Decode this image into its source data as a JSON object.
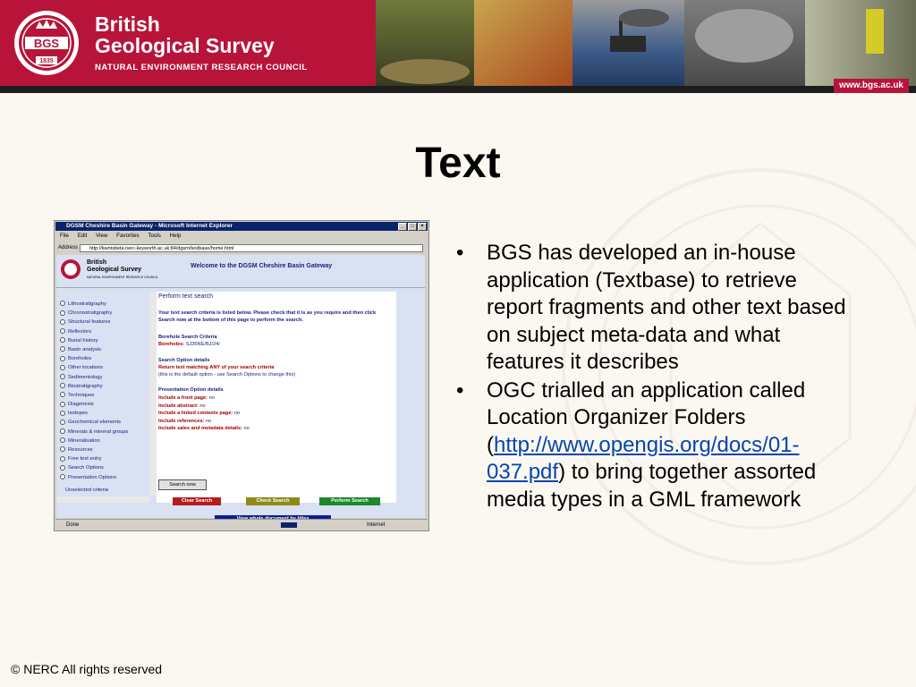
{
  "header": {
    "org_line1": "British",
    "org_line2": "Geological Survey",
    "org_sub": "NATURAL ENVIRONMENT RESEARCH COUNCIL",
    "logo_text": "BGS",
    "logo_year": "1835",
    "url": "www.bgs.ac.uk"
  },
  "slide": {
    "title": "Text",
    "bullets": [
      {
        "text": "BGS has developed an in-house application (Textbase) to retrieve report fragments and other text based on subject meta-data and what features it describes"
      },
      {
        "text_before": "OGC trialled an application called Location Organizer Folders (",
        "link": "http://www.opengis.org/docs/01-037.pdf",
        "text_after": ") to bring together assorted media types in a GML framework"
      }
    ],
    "footer": "© NERC All rights reserved"
  },
  "screenshot": {
    "window_title": "DGSM Cheshire Basin Gateway - Microsoft Internet Explorer",
    "menu": [
      "File",
      "Edit",
      "View",
      "Favorites",
      "Tools",
      "Help"
    ],
    "address_label": "Address",
    "address_value": "http://kwntsbeta.nerc-keyworth.ac.uk:84/dgsm/textbase/home.html",
    "page": {
      "org_line1": "British",
      "org_line2": "Geological Survey",
      "org_sub": "NATURAL ENVIRONMENT RESEARCH COUNCIL",
      "welcome": "Welcome to the DGSM Cheshire Basin Gateway",
      "nav_items": [
        "Lithostratigraphy",
        "Chronostratigraphy",
        "Structural features",
        "Reflectors",
        "Burial history",
        "Basin analysis",
        "Boreholes",
        "Other locations",
        "Sedimentology",
        "Biostratigraphy",
        "Techniques",
        "Diagenesis",
        "Isotopes",
        "Geochemical elements",
        "Minerals & mineral groups",
        "Mineralisation",
        "Resources",
        "Free text entry",
        "Search Options",
        "Presentation Options"
      ],
      "unselected": "Unselected criteria",
      "content_title": "Perform text search",
      "intro": "Your text search criteria is listed below. Please check that it is as you require and then click Search now at the bottom of this page to perform the search.",
      "borehole_heading": "Borehole Search Criteria",
      "borehole_label": "Boreholes:",
      "borehole_value": "SJ36NE/BJ/24/",
      "search_heading": "Search Option details",
      "search_line": "Return text matching ANY of your search criteria",
      "search_note": "(this is the default option - use Search Options to change this)",
      "pres_heading": "Presentation Option details",
      "pres_items": [
        {
          "label": "Include a front page:",
          "value": "no"
        },
        {
          "label": "Include abstract:",
          "value": "no"
        },
        {
          "label": "Include a linked contents page:",
          "value": "no"
        },
        {
          "label": "Include references:",
          "value": "no"
        },
        {
          "label": "Include sales and metadata details:",
          "value": "no"
        }
      ],
      "btn_search_now": "Search now",
      "btn_clear": "Clear Search",
      "btn_check": "Check Search",
      "btn_perform": "Perform Search",
      "btn_view": "View whole document by titles"
    },
    "status_text": "Done",
    "status_zone": "Internet"
  },
  "colors": {
    "banner": "#b8143a",
    "title": "#000000",
    "link": "#0645ad"
  }
}
